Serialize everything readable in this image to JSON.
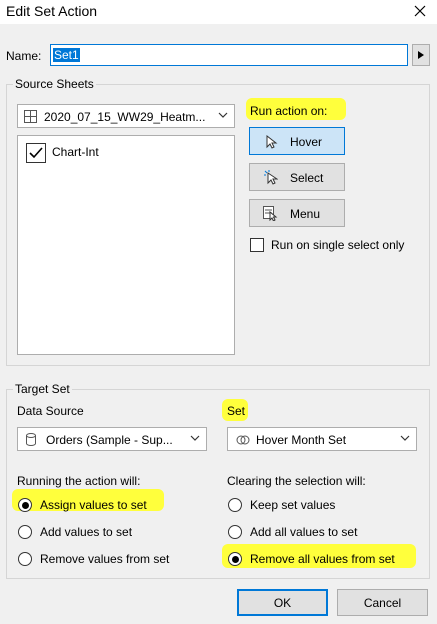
{
  "window": {
    "title": "Edit Set Action"
  },
  "name_field": {
    "label": "Name:",
    "value": "Set1"
  },
  "source_sheets": {
    "legend": "Source Sheets",
    "selected_sheet": "2020_07_15_WW29_Heatm...",
    "sheets": [
      {
        "label": "Chart-Int",
        "checked": true
      }
    ]
  },
  "run_action": {
    "label": "Run action on:",
    "hover_label": "Hover",
    "select_label": "Select",
    "menu_label": "Menu",
    "single_select_label": "Run on single select only"
  },
  "target_set": {
    "legend": "Target Set",
    "data_source_label": "Data Source",
    "data_source_value": "Orders (Sample - Sup...",
    "set_label": "Set",
    "set_value": "Hover Month Set"
  },
  "running_action": {
    "label": "Running the action will:",
    "options": [
      "Assign values to set",
      "Add values to set",
      "Remove values from set"
    ],
    "selected": 0
  },
  "clearing_selection": {
    "label": "Clearing the selection will:",
    "options": [
      "Keep set values",
      "Add all values to set",
      "Remove all values from set"
    ],
    "selected": 2
  },
  "footer": {
    "ok_label": "OK",
    "cancel_label": "Cancel"
  },
  "colors": {
    "highlight": "#ffff3c",
    "accent": "#0078d7"
  }
}
